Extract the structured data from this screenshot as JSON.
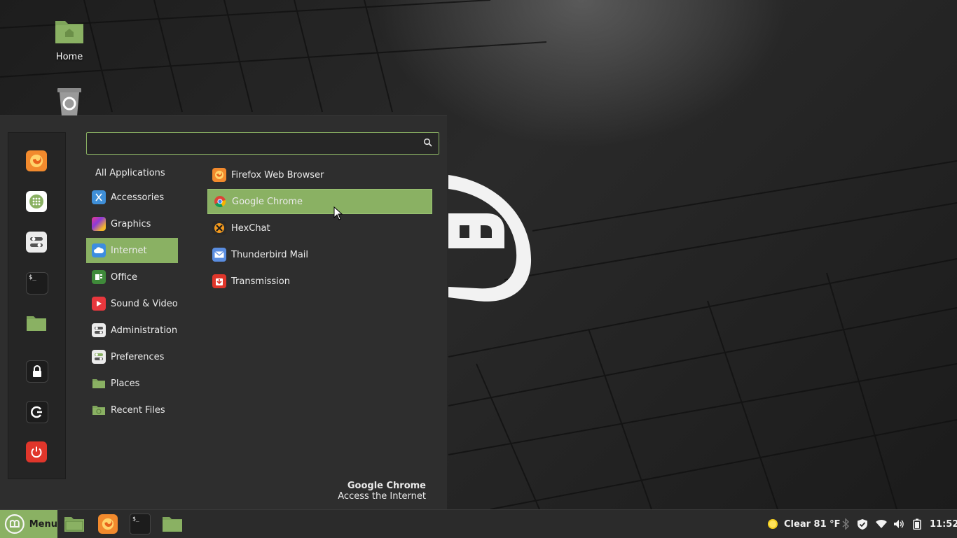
{
  "desktop": {
    "icons": [
      {
        "label": "Home"
      },
      {
        "label": ""
      }
    ]
  },
  "menu": {
    "search": {
      "placeholder": "",
      "value": ""
    },
    "categories": [
      {
        "label": "All Applications"
      },
      {
        "label": "Accessories",
        "icon": "scissors-icon"
      },
      {
        "label": "Graphics",
        "icon": "graphics-icon"
      },
      {
        "label": "Internet",
        "icon": "cloud-icon",
        "selected": true
      },
      {
        "label": "Office",
        "icon": "office-icon"
      },
      {
        "label": "Sound & Video",
        "icon": "play-icon"
      },
      {
        "label": "Administration",
        "icon": "toggles-icon"
      },
      {
        "label": "Preferences",
        "icon": "prefs-icon"
      },
      {
        "label": "Places",
        "icon": "folder-icon"
      },
      {
        "label": "Recent Files",
        "icon": "recent-folder-icon"
      }
    ],
    "apps": [
      {
        "label": "Firefox Web Browser",
        "icon": "firefox-icon"
      },
      {
        "label": "Google Chrome",
        "icon": "chrome-icon",
        "selected": true
      },
      {
        "label": "HexChat",
        "icon": "hexchat-icon"
      },
      {
        "label": "Thunderbird Mail",
        "icon": "mail-icon"
      },
      {
        "label": "Transmission",
        "icon": "transmission-icon"
      }
    ],
    "favorites": [
      "firefox-icon",
      "software-manager-icon",
      "system-settings-icon",
      "terminal-icon",
      "folder-icon",
      "lock-icon",
      "logout-icon",
      "power-icon"
    ],
    "info": {
      "title": "Google Chrome",
      "description": "Access the Internet"
    }
  },
  "taskbar": {
    "menu_label": "Menu",
    "weather": "Clear 81 °F",
    "clock": "11:52"
  },
  "colors": {
    "accent": "#8ab163",
    "panel": "#2e2e2e",
    "taskbar": "#2b2b2b",
    "power": "#e0362b"
  }
}
